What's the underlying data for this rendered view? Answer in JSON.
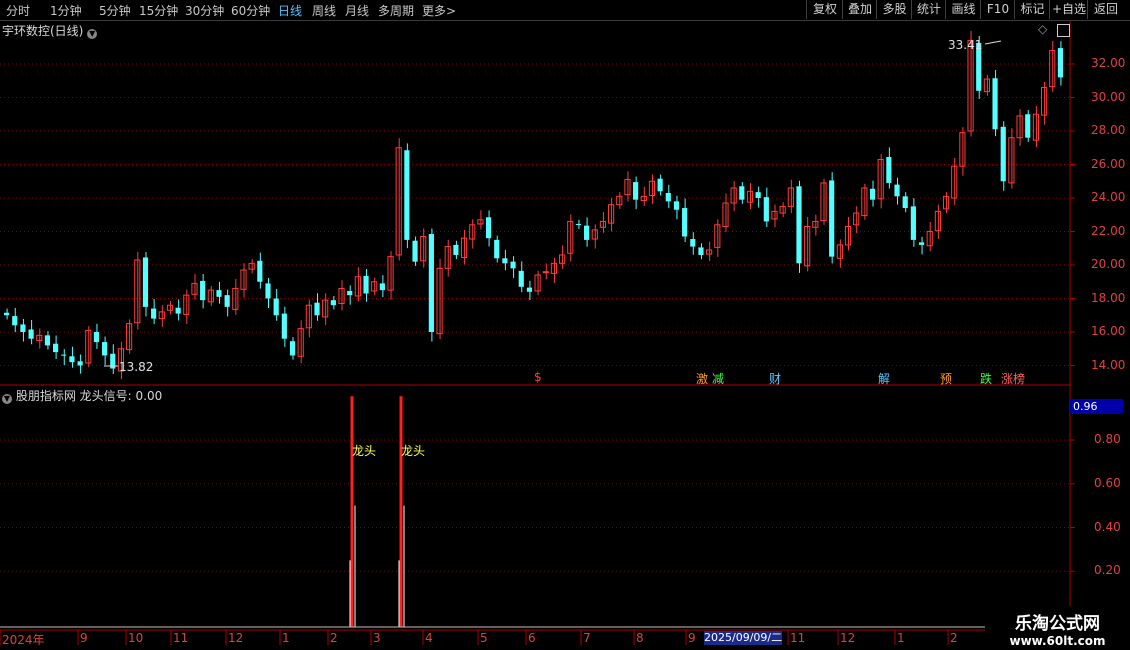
{
  "toolbar": {
    "periods": [
      "分时",
      "1分钟",
      "5分钟",
      "15分钟",
      "30分钟",
      "60分钟",
      "日线",
      "周线",
      "月线",
      "多周期",
      "更多"
    ],
    "more_arrow": ">",
    "buttons": [
      "复权",
      "叠加",
      "多股",
      "统计",
      "画线",
      "F10",
      "标记",
      "+自选",
      "返回"
    ]
  },
  "main_chart": {
    "title": "宇环数控(日线)",
    "y_ticks": [
      "32.00",
      "30.00",
      "28.00",
      "26.00",
      "24.00",
      "22.00",
      "20.00",
      "18.00",
      "16.00",
      "14.00"
    ],
    "high_label": "33.41",
    "low_label": "13.82",
    "events": [
      "$",
      "激",
      "减",
      "财",
      "解",
      "预",
      "跌",
      "涨榜"
    ]
  },
  "indicator": {
    "title": "股朋指标网",
    "signal_label": "龙头信号: 0.00",
    "value_box": "0.96",
    "y_ticks": [
      "0.80",
      "0.60",
      "0.40",
      "0.20"
    ],
    "markers": [
      "龙头",
      "龙头"
    ]
  },
  "x_axis": {
    "labels": [
      "2024年",
      "9",
      "10",
      "11",
      "12",
      "1",
      "2",
      "3",
      "4",
      "5",
      "6",
      "7",
      "8",
      "9",
      "2025/09/09/二",
      "11",
      "12",
      "1",
      "2"
    ]
  },
  "watermark": {
    "line1": "乐淘公式网",
    "line2": "www.60lt.com"
  },
  "colors": {
    "up": "#ff3c3c",
    "down": "#54ffff",
    "grid": "#8b0000",
    "axis": "#b00000",
    "signal": "#ff2020",
    "label": "#ffff50"
  },
  "chart_data": {
    "type": "candlestick",
    "price_range": [
      13.0,
      34.0
    ],
    "close_series": [
      17.0,
      16.4,
      16.0,
      15.6,
      15.8,
      15.2,
      14.8,
      14.6,
      14.2,
      14.0,
      16.1,
      15.4,
      14.6,
      13.82,
      15.0,
      16.5,
      20.3,
      17.5,
      16.8,
      17.2,
      17.6,
      17.1,
      18.2,
      18.9,
      17.9,
      18.5,
      18.1,
      17.5,
      18.6,
      19.7,
      20.1,
      19.0,
      18.0,
      17.0,
      15.6,
      14.6,
      16.2,
      17.6,
      17.0,
      17.9,
      17.6,
      18.6,
      18.2,
      19.3,
      18.3,
      19.0,
      18.5,
      20.5,
      27.0,
      21.5,
      20.2,
      21.7,
      16.0,
      19.8,
      21.1,
      20.6,
      21.6,
      22.4,
      22.7,
      21.6,
      20.4,
      20.1,
      19.8,
      18.7,
      18.4,
      19.4,
      19.6,
      20.1,
      20.6,
      22.6,
      22.4,
      21.5,
      22.1,
      22.6,
      23.6,
      24.1,
      25.1,
      23.9,
      24.1,
      25.0,
      24.4,
      23.8,
      23.3,
      21.7,
      21.1,
      20.6,
      20.9,
      22.4,
      23.7,
      24.6,
      23.9,
      24.4,
      24.0,
      22.6,
      23.2,
      23.5,
      24.6,
      20.1,
      22.3,
      22.6,
      24.9,
      20.5,
      21.2,
      22.3,
      23.1,
      24.6,
      23.9,
      26.3,
      24.9,
      24.1,
      23.4,
      21.5,
      21.2,
      22.0,
      23.2,
      24.1,
      25.9,
      27.9,
      33.41,
      30.4,
      31.1,
      28.1,
      25.0,
      27.6,
      28.9,
      27.6,
      29.0,
      30.6,
      32.8,
      31.2
    ],
    "indicator_series": {
      "signal_days": [
        "2025-02",
        "2025-03"
      ],
      "signal_value": 1.0,
      "range": [
        0,
        1
      ]
    }
  }
}
